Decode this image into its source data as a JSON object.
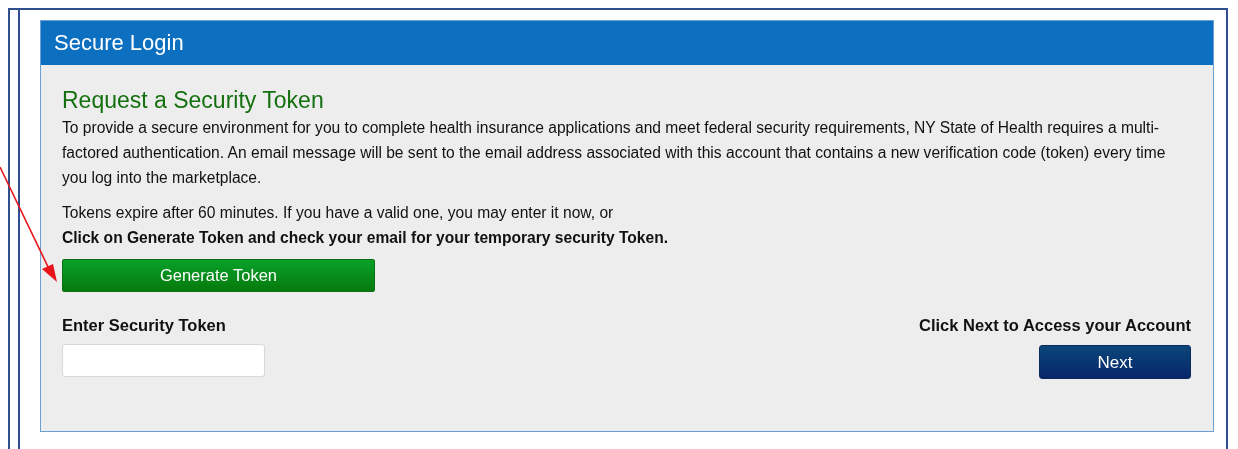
{
  "panel": {
    "title": "Secure Login"
  },
  "heading": "Request a Security Token",
  "intro": "To provide a secure environment for you to complete health insurance applications and meet federal security requirements, NY State of Health requires a multi-factored authentication. An email message will be sent to the email address associated with this account that contains a new verification code (token) every time you log into the marketplace.",
  "expiry_note": "Tokens expire after 60 minutes. If you have a valid one, you may enter it now, or",
  "instruction": "Click on Generate Token and check your email for your temporary security Token.",
  "generate_button": "Generate Token",
  "token_field": {
    "label": "Enter Security Token"
  },
  "next_hint": "Click Next to Access your Account",
  "next_button": "Next"
}
